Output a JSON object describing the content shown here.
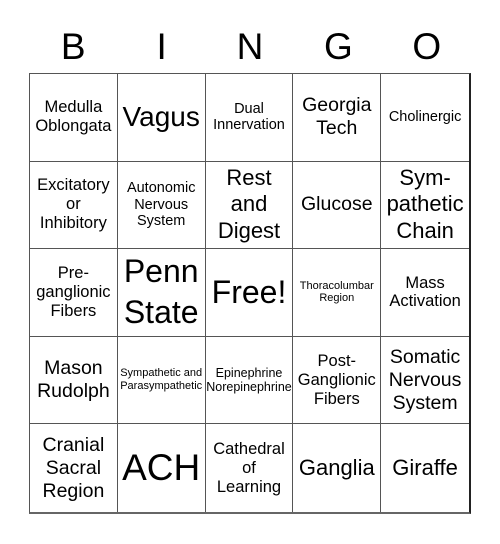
{
  "header": {
    "letters": [
      "B",
      "I",
      "N",
      "G",
      "O"
    ]
  },
  "cells": [
    "Medulla Oblongata",
    "Vagus",
    "Dual Innervation",
    "Georgia Tech",
    "Cholinergic",
    "Excitatory or Inhibitory",
    "Autonomic Nervous System",
    "Rest and Digest",
    "Glucose",
    "Sym-pathetic Chain",
    "Pre-ganglionic Fibers",
    "Penn State",
    "Free!",
    "Thoracolumbar Region",
    "Mass Activation",
    "Mason Rudolph",
    "Sympathetic and Parasympathetic",
    "Epinephrine Norepinephrine",
    "Post-Ganglionic Fibers",
    "Somatic Nervous System",
    "Cranial Sacral Region",
    "ACH",
    "Cathedral of Learning",
    "Ganglia",
    "Giraffe"
  ],
  "lines": {
    "c0": [
      "Medulla",
      "Oblongata"
    ],
    "c2": [
      "Dual",
      "Innervation"
    ],
    "c3": [
      "Georgia",
      "Tech"
    ],
    "c5": [
      "Excitatory",
      "or",
      "Inhibitory"
    ],
    "c6": [
      "Autonomic",
      "Nervous",
      "System"
    ],
    "c7": [
      "Rest",
      "and",
      "Digest"
    ],
    "c9": [
      "Sym-",
      "pathetic",
      "Chain"
    ],
    "c10": [
      "Pre-",
      "ganglionic",
      "Fibers"
    ],
    "c11": [
      "Penn",
      "State"
    ],
    "c13": [
      "Thoracolumbar",
      "Region"
    ],
    "c14": [
      "Mass",
      "Activation"
    ],
    "c15": [
      "Mason",
      "Rudolph"
    ],
    "c16": [
      "Sympathetic and",
      "Parasympathetic"
    ],
    "c17": [
      "Epinephrine",
      "Norepinephrine"
    ],
    "c18": [
      "Post-",
      "Ganglionic",
      "Fibers"
    ],
    "c19": [
      "Somatic",
      "Nervous",
      "System"
    ],
    "c20": [
      "Cranial",
      "Sacral",
      "Region"
    ],
    "c22": [
      "Cathedral",
      "of",
      "Learning"
    ]
  }
}
